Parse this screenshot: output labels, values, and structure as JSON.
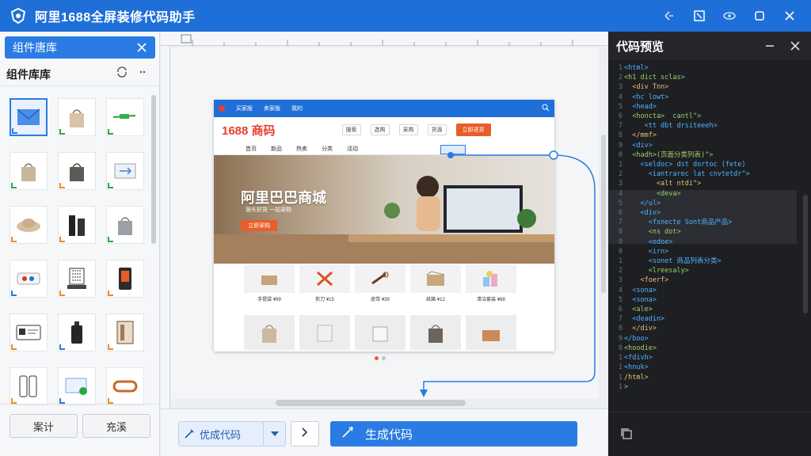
{
  "app": {
    "title": "阿里1688全屏装修代码助手",
    "accent": "#1f6fd8"
  },
  "left_panel": {
    "tab_label": "组件唐库",
    "section_title": "组件库库",
    "buttons": {
      "left": "案计",
      "right": "充溪"
    },
    "components": [
      {
        "name": "envelope",
        "badge": "blue",
        "selected": true
      },
      {
        "name": "tote-bag-beige",
        "badge": "green"
      },
      {
        "name": "green-banner",
        "badge": "green"
      },
      {
        "name": "tote-bag-canvas",
        "badge": "green"
      },
      {
        "name": "tote-bag-dark",
        "badge": "orange"
      },
      {
        "name": "arrow-card",
        "badge": "green"
      },
      {
        "name": "hat",
        "badge": "orange"
      },
      {
        "name": "black-bottles",
        "badge": "orange"
      },
      {
        "name": "grey-bag",
        "badge": "green"
      },
      {
        "name": "toggle-card",
        "badge": "blue"
      },
      {
        "name": "qr-sign",
        "badge": "orange"
      },
      {
        "name": "phone-stand",
        "badge": "orange"
      },
      {
        "name": "id-card",
        "badge": "orange"
      },
      {
        "name": "bottle",
        "badge": "blue"
      },
      {
        "name": "door-frame",
        "badge": "orange"
      },
      {
        "name": "phone-pair",
        "badge": "orange"
      },
      {
        "name": "card-check",
        "badge": "blue"
      },
      {
        "name": "ring-box",
        "badge": "orange"
      }
    ]
  },
  "preview": {
    "brand": "1688 商码",
    "nav_items": [
      "买家版",
      "卖家版",
      "我的"
    ],
    "chips": [
      "搜索",
      "选购",
      "采购",
      "货源"
    ],
    "cta": "立即进货",
    "categories": [
      "首页",
      "新品",
      "热卖",
      "分类",
      "活动"
    ],
    "hero_title": "阿里巴巴商城",
    "hero_sub": "源头好货 一站采购",
    "hero_button": "立即采购",
    "products": [
      {
        "caption": "手提袋 ¥99"
      },
      {
        "caption": "剪刀 ¥15"
      },
      {
        "caption": "皮带 ¥39"
      },
      {
        "caption": "纸箱 ¥12"
      },
      {
        "caption": "清洁套装 ¥88"
      }
    ]
  },
  "toolbar": {
    "split_label": "优成代码",
    "generate_label": "生成代码"
  },
  "code_panel": {
    "title": "代码预览",
    "line_numbers": [
      "1",
      "2",
      "3",
      "4",
      "5",
      "6",
      "7",
      "8",
      "9",
      "0",
      "1",
      "2",
      "3",
      "4",
      "5",
      "6",
      "7",
      "8",
      "9",
      "0",
      "1",
      "2",
      "3",
      "4",
      "5",
      "6",
      "7",
      "8",
      "9",
      "0",
      "1",
      "1",
      "1",
      "1"
    ],
    "lines": [
      "<html>",
      "<h1 dict sclas>",
      "  <div Tnn>",
      "  <hc lowt>",
      "  <head>",
      "  <honcta>  cantl\">",
      "     <tt dbt drsiteeeh>",
      "  </mmf>",
      "  <div>",
      "  <hadh>(页面分类列表)\">",
      "    <seldoc> dst dortoc (fete)",
      "      <iantrarec lat cnvtetdr\">",
      "        <alt ntdi\">",
      "        <deva>",
      "    </ul>",
      "    <div>",
      "      <fxnecte Sont商品产品>",
      "      <ns dot>",
      "      <edoe>",
      "      <irn>",
      "      <sonet 商品列表分类>",
      "      <lreesaly>",
      "    <foerf>",
      "  <sona>",
      "  <sona>",
      "  <ale>",
      "  <deadin>",
      "  </div>",
      "</boo>",
      "<hoodie>",
      "<fdivh>",
      "<hnuk>",
      "/html>",
      ">"
    ]
  }
}
